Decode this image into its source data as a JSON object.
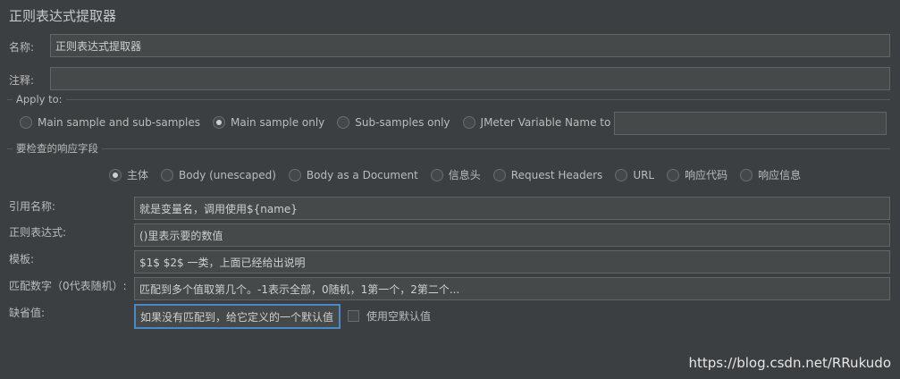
{
  "panel": {
    "title": "正则表达式提取器"
  },
  "name_field": {
    "label": "名称:",
    "value": "正则表达式提取器"
  },
  "comment_field": {
    "label": "注释:",
    "value": ""
  },
  "apply_to": {
    "title": "Apply to:",
    "options": [
      "Main sample and sub-samples",
      "Main sample only",
      "Sub-samples only",
      "JMeter Variable Name to use"
    ],
    "selected": "Main sample only",
    "variable_value": ""
  },
  "response_field": {
    "title": "要检查的响应字段",
    "options": [
      "主体",
      "Body (unescaped)",
      "Body as a Document",
      "信息头",
      "Request Headers",
      "URL",
      "响应代码",
      "响应信息"
    ],
    "selected": "主体"
  },
  "form": {
    "ref_name": {
      "label": "引用名称:",
      "value": "就是变量名，调用使用${name}"
    },
    "regex": {
      "label": "正则表达式:",
      "value": "()里表示要的数值"
    },
    "template": {
      "label": "模板:",
      "value": "$1$ $2$ 一类，上面已经给出说明"
    },
    "match_no": {
      "label": "匹配数字（0代表随机）:",
      "value": "匹配到多个值取第几个。-1表示全部，0随机，1第一个，2第二个..."
    },
    "default": {
      "label": "缺省值:",
      "value": "如果没有匹配到，给它定义的一个默认值"
    },
    "use_empty_default": {
      "label": "使用空默认值",
      "checked": false
    }
  },
  "watermark": "https://blog.csdn.net/RRukudo"
}
